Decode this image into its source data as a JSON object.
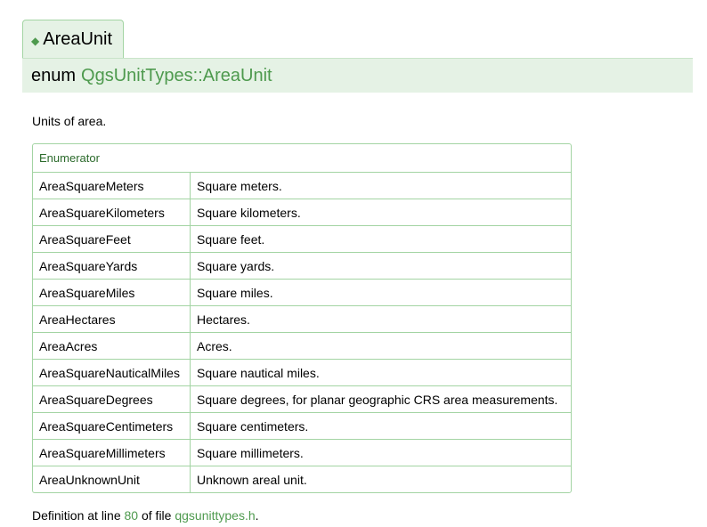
{
  "section": {
    "tab_title": "AreaUnit",
    "keyword": "enum",
    "qualified_name": "QgsUnitTypes::AreaUnit",
    "description": "Units of area."
  },
  "table": {
    "header": "Enumerator",
    "rows": [
      {
        "name": "AreaSquareMeters",
        "description": "Square meters."
      },
      {
        "name": "AreaSquareKilometers",
        "description": "Square kilometers."
      },
      {
        "name": "AreaSquareFeet",
        "description": "Square feet."
      },
      {
        "name": "AreaSquareYards",
        "description": "Square yards."
      },
      {
        "name": "AreaSquareMiles",
        "description": "Square miles."
      },
      {
        "name": "AreaHectares",
        "description": "Hectares."
      },
      {
        "name": "AreaAcres",
        "description": "Acres."
      },
      {
        "name": "AreaSquareNauticalMiles",
        "description": "Square nautical miles."
      },
      {
        "name": "AreaSquareDegrees",
        "description": "Square degrees, for planar geographic CRS area measurements."
      },
      {
        "name": "AreaSquareCentimeters",
        "description": "Square centimeters."
      },
      {
        "name": "AreaSquareMillimeters",
        "description": "Square millimeters."
      },
      {
        "name": "AreaUnknownUnit",
        "description": "Unknown areal unit."
      }
    ]
  },
  "footer": {
    "prefix": "Definition at line",
    "line": "80",
    "middle": "of file",
    "file": "qgsunittypes.h",
    "suffix": "."
  },
  "colors": {
    "accent": "#4e9a4e",
    "band_background": "#e5f2e5",
    "border": "#a3d4a3"
  }
}
